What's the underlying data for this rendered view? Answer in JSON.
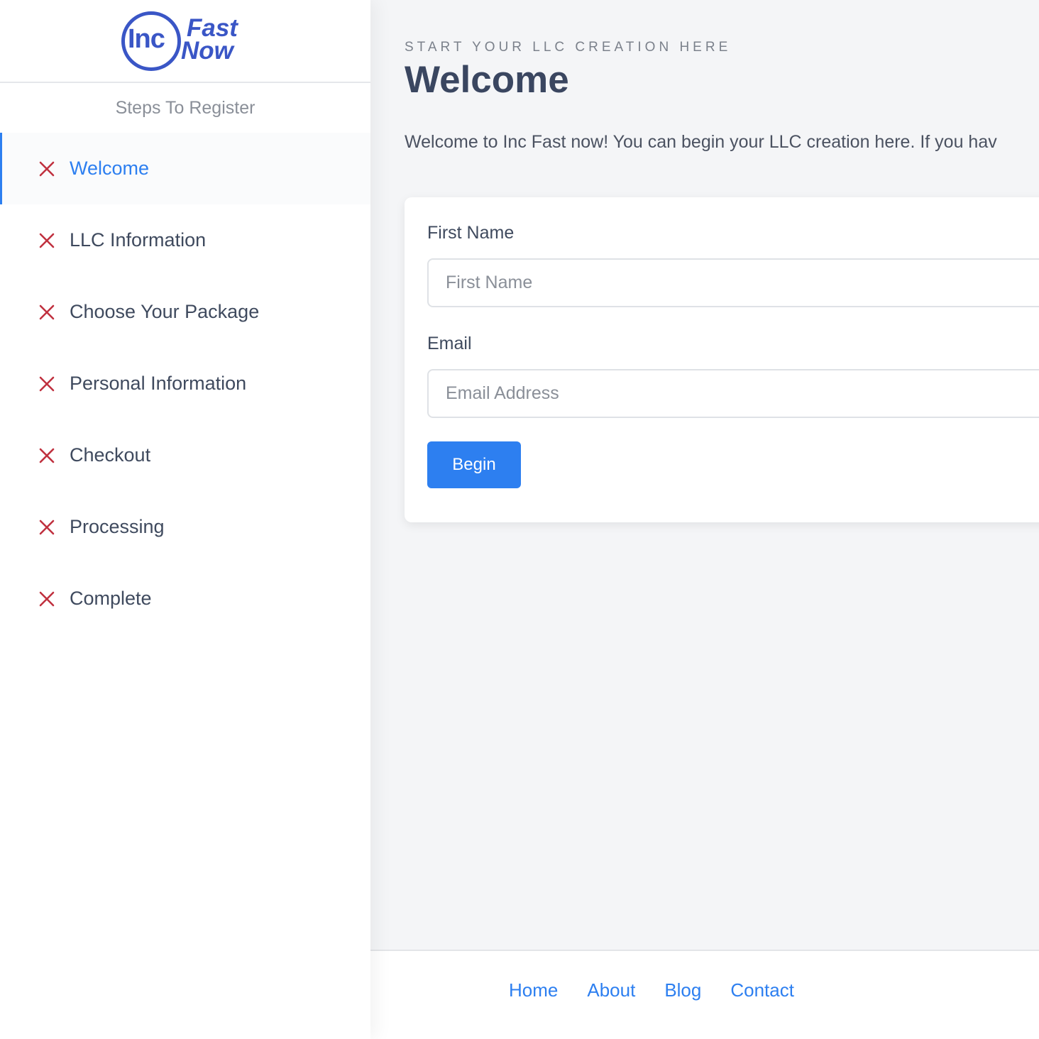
{
  "brand": {
    "logo_text_inc": "Inc",
    "logo_text_fast": "Fast",
    "logo_text_now": "Now",
    "color": "#3a56c6"
  },
  "sidebar": {
    "title": "Steps To Register",
    "active_color": "#2d7ff0",
    "status_icon": "x-icon",
    "status_color": "#c0313f",
    "items": [
      {
        "label": "Welcome",
        "active": true
      },
      {
        "label": "LLC Information",
        "active": false
      },
      {
        "label": "Choose Your Package",
        "active": false
      },
      {
        "label": "Personal Information",
        "active": false
      },
      {
        "label": "Checkout",
        "active": false
      },
      {
        "label": "Processing",
        "active": false
      },
      {
        "label": "Complete",
        "active": false
      }
    ]
  },
  "main": {
    "eyebrow": "START YOUR LLC CREATION HERE",
    "title": "Welcome",
    "intro": "Welcome to Inc Fast now! You can begin your LLC creation here. If you hav",
    "form": {
      "first_name_label": "First Name",
      "first_name_placeholder": "First Name",
      "first_name_value": "",
      "email_label": "Email",
      "email_placeholder": "Email Address",
      "email_value": "",
      "submit_label": "Begin"
    }
  },
  "footer": {
    "links": [
      "Home",
      "About",
      "Blog",
      "Contact"
    ]
  }
}
